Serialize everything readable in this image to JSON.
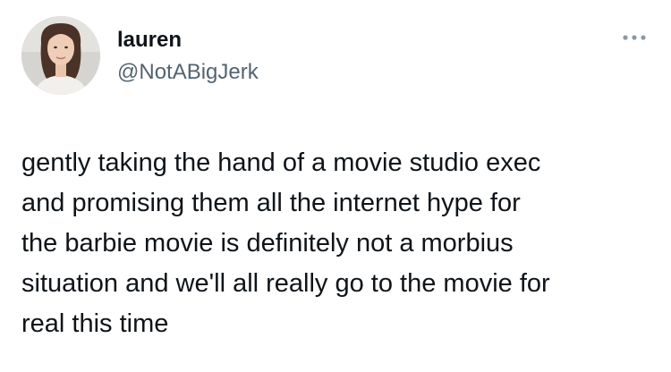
{
  "author": {
    "display_name": "lauren",
    "handle": "@NotABigJerk"
  },
  "icons": {
    "more": "more-horizontal-icon",
    "avatar": "profile-photo"
  },
  "tweet": {
    "text": "gently taking the hand of a movie studio exec\nand promising them all the internet hype for\nthe barbie movie is definitely not a morbius\nsituation and we'll all really go to the movie for\nreal this time"
  },
  "colors": {
    "text": "#0f1419",
    "secondary_text": "#536471",
    "background": "#ffffff"
  }
}
